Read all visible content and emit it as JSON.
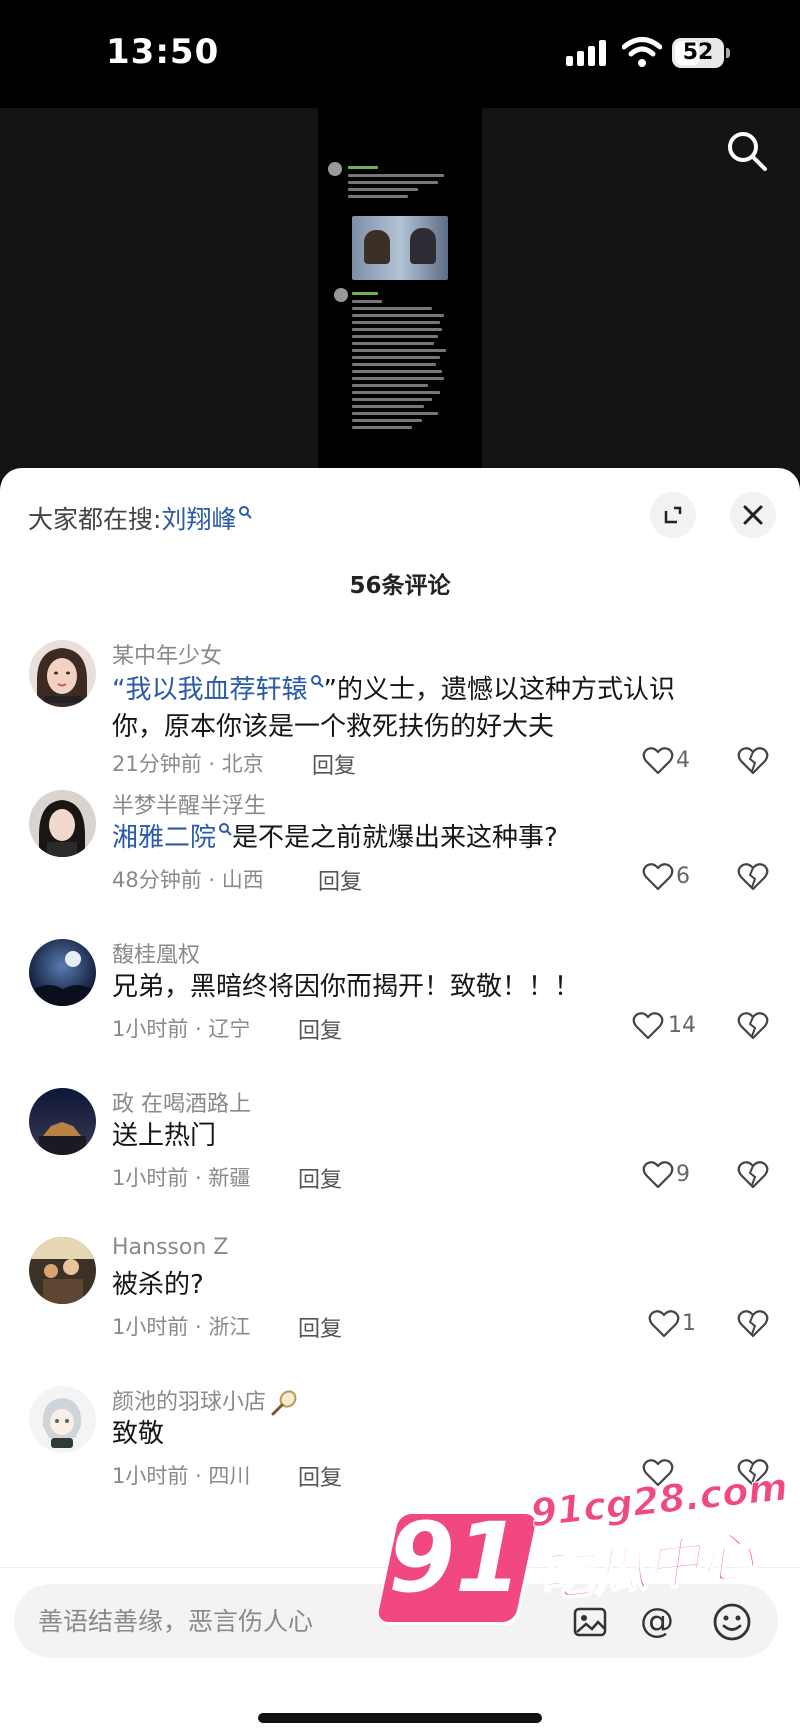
{
  "status_bar": {
    "time": "13:50",
    "battery_level": 52
  },
  "sheet": {
    "search_hint": {
      "label": "大家都在搜:",
      "term": "刘翔峰"
    },
    "comment_count": "56条评论"
  },
  "comments": [
    {
      "username": "某中年少女",
      "text_parts": {
        "open_quote": "“",
        "link": "我以我血荐轩辕",
        "rest_line1": "”的义士，遗憾以这种方式认识",
        "rest_line2": "你，原本你该是一个救死扶伤的好大夫"
      },
      "time": "21分钟前 · 北京",
      "reply": "回复",
      "likes": "4"
    },
    {
      "username": "半梦半醒半浮生",
      "text_parts": {
        "link": "湘雅二院",
        "rest": "是不是之前就爆出来这种事?"
      },
      "time": "48分钟前 · 山西",
      "reply": "回复",
      "likes": "6"
    },
    {
      "username": "馥桂凰权",
      "text": "兄弟，黑暗终将因你而揭开！致敬！！！",
      "time": "1小时前 · 辽宁",
      "reply": "回复",
      "likes": "14"
    },
    {
      "username": "政 在喝酒路上",
      "text": "送上热门",
      "time": "1小时前 · 新疆",
      "reply": "回复",
      "likes": "9"
    },
    {
      "username": "Hansson Z",
      "text": "被杀的?",
      "time": "1小时前 · 浙江",
      "reply": "回复",
      "likes": "1"
    },
    {
      "username": "颜池的羽球小店",
      "text": "致敬",
      "time": "1小时前 · 四川",
      "reply": "回复"
    }
  ],
  "input_bar": {
    "placeholder": "善语结善缘，恶言伤人心"
  },
  "watermark": {
    "number": "91",
    "domain": "91cg28.com",
    "title": "吃瓜中心"
  },
  "colors": {
    "link": "#2b5aa8",
    "watermark": "#f0487f",
    "sheet_bg": "#ffffff"
  },
  "icons": [
    "signal-icon",
    "wifi-icon",
    "battery-icon",
    "search-icon",
    "expand-icon",
    "close-icon",
    "like-icon",
    "dislike-icon",
    "image-icon",
    "at-icon",
    "emoji-icon",
    "badminton-racket-icon"
  ]
}
